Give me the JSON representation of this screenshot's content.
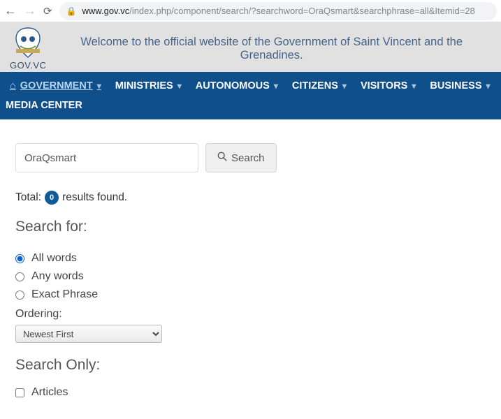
{
  "browser": {
    "host": "www.gov.vc",
    "path": "/index.php/component/search/?searchword=OraQsmart&searchphrase=all&Itemid=28"
  },
  "header": {
    "site_label": "GOV.VC",
    "welcome": "Welcome to the official website of the Government of Saint Vincent and the Grenadines."
  },
  "nav": {
    "items": [
      "GOVERNMENT",
      "MINISTRIES",
      "AUTONOMOUS",
      "CITIZENS",
      "VISITORS",
      "BUSINESS"
    ],
    "secondary": "MEDIA CENTER"
  },
  "search": {
    "value": "OraQsmart",
    "button": "Search",
    "total_label_pre": "Total:",
    "total_count": "0",
    "total_label_post": "results found.",
    "search_for": "Search for:",
    "radios": [
      "All words",
      "Any words",
      "Exact Phrase"
    ],
    "ordering_label": "Ordering:",
    "ordering_selected": "Newest First",
    "search_only": "Search Only:",
    "checkbox_articles": "Articles"
  }
}
